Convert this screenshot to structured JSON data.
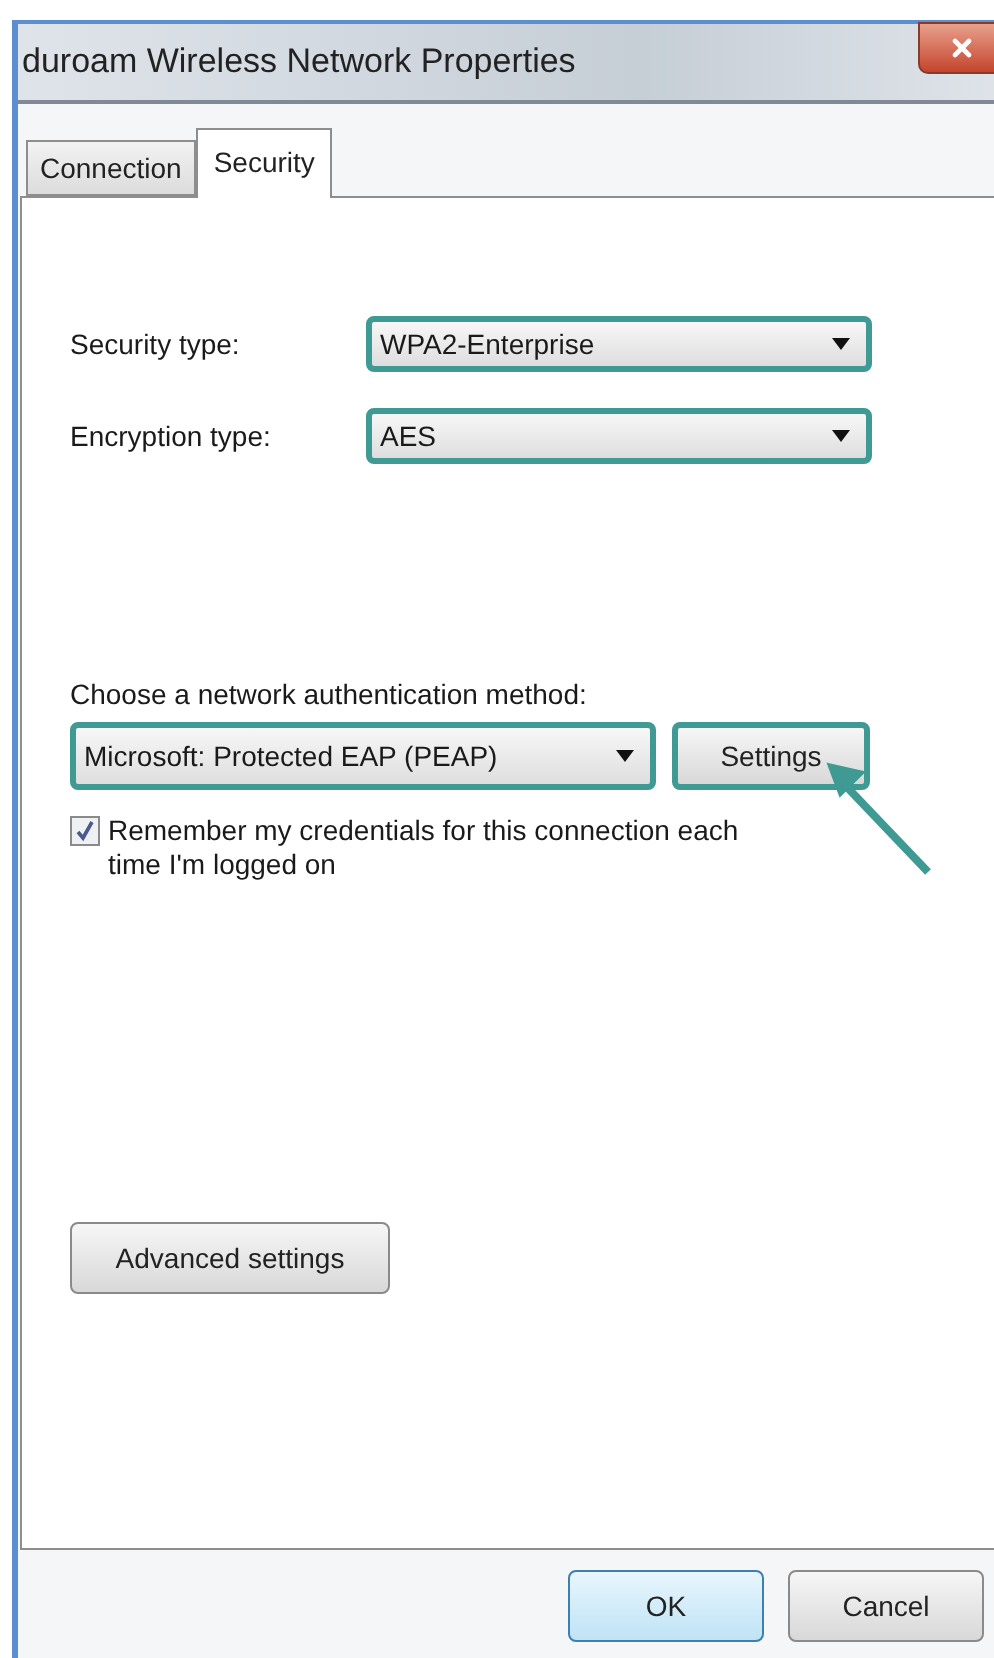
{
  "window": {
    "title": "duroam Wireless Network Properties"
  },
  "tabs": [
    {
      "label": "Connection",
      "selected": false
    },
    {
      "label": "Security",
      "selected": true
    }
  ],
  "fields": [
    {
      "label": "Security type:",
      "value": "WPA2-Enterprise",
      "highlighted": true
    },
    {
      "label": "Encryption type:",
      "value": "AES",
      "highlighted": true
    }
  ],
  "authentication": {
    "label": "Choose a network authentication method:",
    "method": {
      "value": "Microsoft: Protected EAP (PEAP)",
      "highlighted": true
    },
    "settings_button": {
      "label": "Settings",
      "highlighted": true
    },
    "remember": {
      "label": "Remember my credentials for this connection each time I'm logged on",
      "checked": true
    }
  },
  "advanced_button": {
    "label": "Advanced settings",
    "highlighted": false
  },
  "buttons": [
    {
      "label": "OK",
      "selected": true
    },
    {
      "label": "Cancel",
      "selected": false
    }
  ]
}
